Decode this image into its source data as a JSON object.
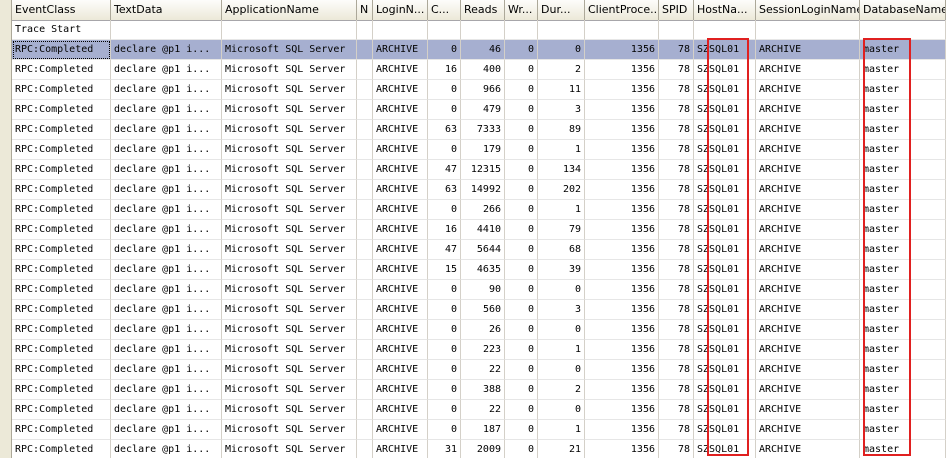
{
  "columns": [
    {
      "key": "event",
      "label": "EventClass"
    },
    {
      "key": "text",
      "label": "TextData"
    },
    {
      "key": "app",
      "label": "ApplicationName"
    },
    {
      "key": "n",
      "label": "N"
    },
    {
      "key": "login",
      "label": "LoginN..."
    },
    {
      "key": "cpu",
      "label": "C..."
    },
    {
      "key": "reads",
      "label": "Reads"
    },
    {
      "key": "writes",
      "label": "Wr..."
    },
    {
      "key": "dur",
      "label": "Dur..."
    },
    {
      "key": "cpid",
      "label": "ClientProce..."
    },
    {
      "key": "spid",
      "label": "SPID"
    },
    {
      "key": "host",
      "label": "HostNa..."
    },
    {
      "key": "slogin",
      "label": "SessionLoginName"
    },
    {
      "key": "db",
      "label": "DatabaseName"
    }
  ],
  "trace_start": "Trace Start",
  "rows": [
    {
      "event": "RPC:Completed",
      "text": "declare @p1 i...",
      "app": "Microsoft SQL Server",
      "login": "ARCHIVE",
      "cpu": "0",
      "reads": "46",
      "writes": "0",
      "dur": "0",
      "cpid": "1356",
      "spid": "78",
      "host": "SZSQL01",
      "slogin": "ARCHIVE",
      "db": "master"
    },
    {
      "event": "RPC:Completed",
      "text": "declare @p1 i...",
      "app": "Microsoft SQL Server",
      "login": "ARCHIVE",
      "cpu": "16",
      "reads": "400",
      "writes": "0",
      "dur": "2",
      "cpid": "1356",
      "spid": "78",
      "host": "SZSQL01",
      "slogin": "ARCHIVE",
      "db": "master"
    },
    {
      "event": "RPC:Completed",
      "text": "declare @p1 i...",
      "app": "Microsoft SQL Server",
      "login": "ARCHIVE",
      "cpu": "0",
      "reads": "966",
      "writes": "0",
      "dur": "11",
      "cpid": "1356",
      "spid": "78",
      "host": "SZSQL01",
      "slogin": "ARCHIVE",
      "db": "master"
    },
    {
      "event": "RPC:Completed",
      "text": "declare @p1 i...",
      "app": "Microsoft SQL Server",
      "login": "ARCHIVE",
      "cpu": "0",
      "reads": "479",
      "writes": "0",
      "dur": "3",
      "cpid": "1356",
      "spid": "78",
      "host": "SZSQL01",
      "slogin": "ARCHIVE",
      "db": "master"
    },
    {
      "event": "RPC:Completed",
      "text": "declare @p1 i...",
      "app": "Microsoft SQL Server",
      "login": "ARCHIVE",
      "cpu": "63",
      "reads": "7333",
      "writes": "0",
      "dur": "89",
      "cpid": "1356",
      "spid": "78",
      "host": "SZSQL01",
      "slogin": "ARCHIVE",
      "db": "master"
    },
    {
      "event": "RPC:Completed",
      "text": "declare @p1 i...",
      "app": "Microsoft SQL Server",
      "login": "ARCHIVE",
      "cpu": "0",
      "reads": "179",
      "writes": "0",
      "dur": "1",
      "cpid": "1356",
      "spid": "78",
      "host": "SZSQL01",
      "slogin": "ARCHIVE",
      "db": "master"
    },
    {
      "event": "RPC:Completed",
      "text": "declare @p1 i...",
      "app": "Microsoft SQL Server",
      "login": "ARCHIVE",
      "cpu": "47",
      "reads": "12315",
      "writes": "0",
      "dur": "134",
      "cpid": "1356",
      "spid": "78",
      "host": "SZSQL01",
      "slogin": "ARCHIVE",
      "db": "master"
    },
    {
      "event": "RPC:Completed",
      "text": "declare @p1 i...",
      "app": "Microsoft SQL Server",
      "login": "ARCHIVE",
      "cpu": "63",
      "reads": "14992",
      "writes": "0",
      "dur": "202",
      "cpid": "1356",
      "spid": "78",
      "host": "SZSQL01",
      "slogin": "ARCHIVE",
      "db": "master"
    },
    {
      "event": "RPC:Completed",
      "text": "declare @p1 i...",
      "app": "Microsoft SQL Server",
      "login": "ARCHIVE",
      "cpu": "0",
      "reads": "266",
      "writes": "0",
      "dur": "1",
      "cpid": "1356",
      "spid": "78",
      "host": "SZSQL01",
      "slogin": "ARCHIVE",
      "db": "master"
    },
    {
      "event": "RPC:Completed",
      "text": "declare @p1 i...",
      "app": "Microsoft SQL Server",
      "login": "ARCHIVE",
      "cpu": "16",
      "reads": "4410",
      "writes": "0",
      "dur": "79",
      "cpid": "1356",
      "spid": "78",
      "host": "SZSQL01",
      "slogin": "ARCHIVE",
      "db": "master"
    },
    {
      "event": "RPC:Completed",
      "text": "declare @p1 i...",
      "app": "Microsoft SQL Server",
      "login": "ARCHIVE",
      "cpu": "47",
      "reads": "5644",
      "writes": "0",
      "dur": "68",
      "cpid": "1356",
      "spid": "78",
      "host": "SZSQL01",
      "slogin": "ARCHIVE",
      "db": "master"
    },
    {
      "event": "RPC:Completed",
      "text": "declare @p1 i...",
      "app": "Microsoft SQL Server",
      "login": "ARCHIVE",
      "cpu": "15",
      "reads": "4635",
      "writes": "0",
      "dur": "39",
      "cpid": "1356",
      "spid": "78",
      "host": "SZSQL01",
      "slogin": "ARCHIVE",
      "db": "master"
    },
    {
      "event": "RPC:Completed",
      "text": "declare @p1 i...",
      "app": "Microsoft SQL Server",
      "login": "ARCHIVE",
      "cpu": "0",
      "reads": "90",
      "writes": "0",
      "dur": "0",
      "cpid": "1356",
      "spid": "78",
      "host": "SZSQL01",
      "slogin": "ARCHIVE",
      "db": "master"
    },
    {
      "event": "RPC:Completed",
      "text": "declare @p1 i...",
      "app": "Microsoft SQL Server",
      "login": "ARCHIVE",
      "cpu": "0",
      "reads": "560",
      "writes": "0",
      "dur": "3",
      "cpid": "1356",
      "spid": "78",
      "host": "SZSQL01",
      "slogin": "ARCHIVE",
      "db": "master"
    },
    {
      "event": "RPC:Completed",
      "text": "declare @p1 i...",
      "app": "Microsoft SQL Server",
      "login": "ARCHIVE",
      "cpu": "0",
      "reads": "26",
      "writes": "0",
      "dur": "0",
      "cpid": "1356",
      "spid": "78",
      "host": "SZSQL01",
      "slogin": "ARCHIVE",
      "db": "master"
    },
    {
      "event": "RPC:Completed",
      "text": "declare @p1 i...",
      "app": "Microsoft SQL Server",
      "login": "ARCHIVE",
      "cpu": "0",
      "reads": "223",
      "writes": "0",
      "dur": "1",
      "cpid": "1356",
      "spid": "78",
      "host": "SZSQL01",
      "slogin": "ARCHIVE",
      "db": "master"
    },
    {
      "event": "RPC:Completed",
      "text": "declare @p1 i...",
      "app": "Microsoft SQL Server",
      "login": "ARCHIVE",
      "cpu": "0",
      "reads": "22",
      "writes": "0",
      "dur": "0",
      "cpid": "1356",
      "spid": "78",
      "host": "SZSQL01",
      "slogin": "ARCHIVE",
      "db": "master"
    },
    {
      "event": "RPC:Completed",
      "text": "declare @p1 i...",
      "app": "Microsoft SQL Server",
      "login": "ARCHIVE",
      "cpu": "0",
      "reads": "388",
      "writes": "0",
      "dur": "2",
      "cpid": "1356",
      "spid": "78",
      "host": "SZSQL01",
      "slogin": "ARCHIVE",
      "db": "master"
    },
    {
      "event": "RPC:Completed",
      "text": "declare @p1 i...",
      "app": "Microsoft SQL Server",
      "login": "ARCHIVE",
      "cpu": "0",
      "reads": "22",
      "writes": "0",
      "dur": "0",
      "cpid": "1356",
      "spid": "78",
      "host": "SZSQL01",
      "slogin": "ARCHIVE",
      "db": "master"
    },
    {
      "event": "RPC:Completed",
      "text": "declare @p1 i...",
      "app": "Microsoft SQL Server",
      "login": "ARCHIVE",
      "cpu": "0",
      "reads": "187",
      "writes": "0",
      "dur": "1",
      "cpid": "1356",
      "spid": "78",
      "host": "SZSQL01",
      "slogin": "ARCHIVE",
      "db": "master"
    },
    {
      "event": "RPC:Completed",
      "text": "declare @p1 i...",
      "app": "Microsoft SQL Server",
      "login": "ARCHIVE",
      "cpu": "31",
      "reads": "2009",
      "writes": "0",
      "dur": "21",
      "cpid": "1356",
      "spid": "78",
      "host": "SZSQL01",
      "slogin": "ARCHIVE",
      "db": "master"
    }
  ],
  "selected_row": 0,
  "colors": {
    "selection": "#a6afd0",
    "highlight_box": "#e02020",
    "header_bg": "#ece9d8"
  }
}
